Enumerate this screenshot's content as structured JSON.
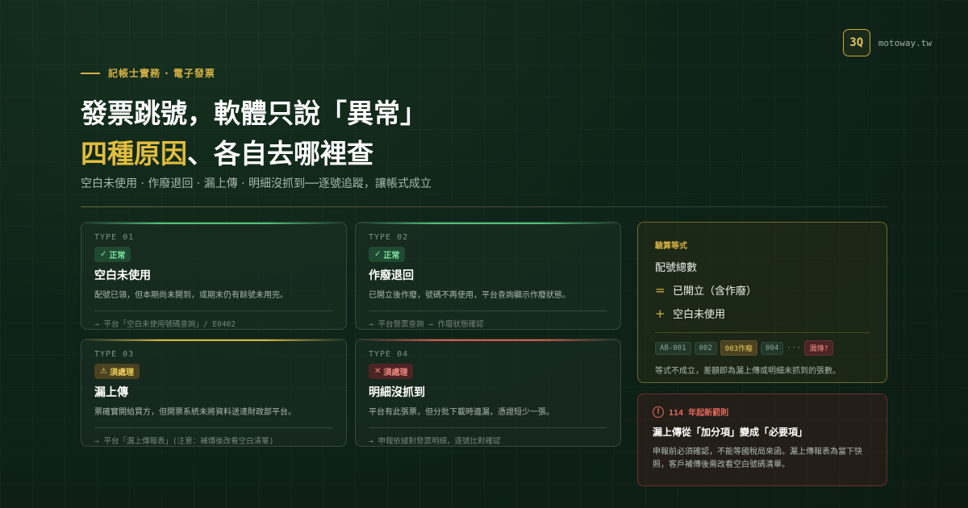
{
  "brand": {
    "logo": "3Q",
    "domain": "motoway.tw"
  },
  "header": {
    "eyebrow": "記帳士實務 · 電子發票",
    "title_line1": "發票跳號，軟體只說「異常」",
    "title_line2_highlight": "四種原因",
    "title_line2_rest": "、各自去哪裡查",
    "subtitle": "空白未使用 · 作廢退回 · 漏上傳 · 明細沒抓到──逐號追蹤，讓帳式成立"
  },
  "cards": [
    {
      "type": "TYPE 01",
      "badge_icon": "✓",
      "badge": "正常",
      "status": "ok",
      "accent": "#4fc27a",
      "title": "空白未使用",
      "desc": "配號已領，但本期尚未開到，或期末仍有餘號未用完。",
      "foot": "→ 平台「空白未使用號碼查詢」/ E0402"
    },
    {
      "type": "TYPE 02",
      "badge_icon": "✓",
      "badge": "正常",
      "status": "ok",
      "accent": "#4fc27a",
      "title": "作廢退回",
      "desc": "已開立後作廢，號碼不再使用，平台查詢顯示作廢狀態。",
      "foot": "→ 平台發票查詢 → 作廢狀態確認"
    },
    {
      "type": "TYPE 03",
      "badge_icon": "⚠",
      "badge": "須處理",
      "status": "warn",
      "accent": "#d8b43c",
      "title": "漏上傳",
      "desc": "票確實開給買方，但開票系統未將資料送達財政部平台。",
      "foot": "→ 平台「漏上傳報表」(注意：補傳後改看空白清單)"
    },
    {
      "type": "TYPE 04",
      "badge_icon": "✕",
      "badge": "須處理",
      "status": "err",
      "accent": "#d9574d",
      "title": "明細沒抓到",
      "desc": "平台有此張票，但分批下載時遺漏，憑證短少一張。",
      "foot": "→ 申報依據對發票明細，逐號比對確認"
    }
  ],
  "equation": {
    "label": "驗算等式",
    "line1": "配號總數",
    "op2": "=",
    "line2": "已開立（含作廢）",
    "op3": "+",
    "line3": "空白未使用",
    "chips": [
      "AB-001",
      "002",
      "003作廢",
      "004",
      "···",
      "漏傳?"
    ],
    "note": "等式不成立，差額即為漏上傳或明細未抓到的張數。"
  },
  "rule": {
    "icon": "!",
    "tag": "114 年起新罰則",
    "title": "漏上傳從「加分項」變成「必要項」",
    "body": "申報前必須確認，不能等國稅局來函。漏上傳報表為當下快照，客戶補傳後需改看空白號碼清單。"
  }
}
